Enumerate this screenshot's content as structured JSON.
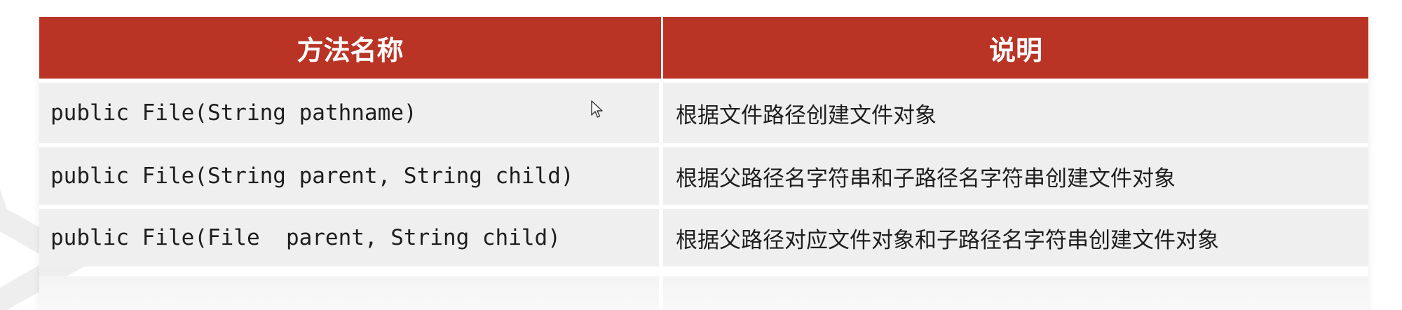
{
  "table": {
    "headers": {
      "method": "方法名称",
      "description": "说明"
    },
    "rows": [
      {
        "method": "public File(String pathname)",
        "description": "根据文件路径创建文件对象"
      },
      {
        "method": "public File(String parent, String child)",
        "description": "根据父路径名字符串和子路径名字符串创建文件对象"
      },
      {
        "method": "public File(File  parent, String child)",
        "description": "根据父路径对应文件对象和子路径名字符串创建文件对象"
      }
    ]
  },
  "colors": {
    "header_bg": "#b93425",
    "row_bg": "#efefef",
    "header_text": "#ffffff"
  },
  "icons": {
    "cursor": "mouse-pointer-icon"
  }
}
